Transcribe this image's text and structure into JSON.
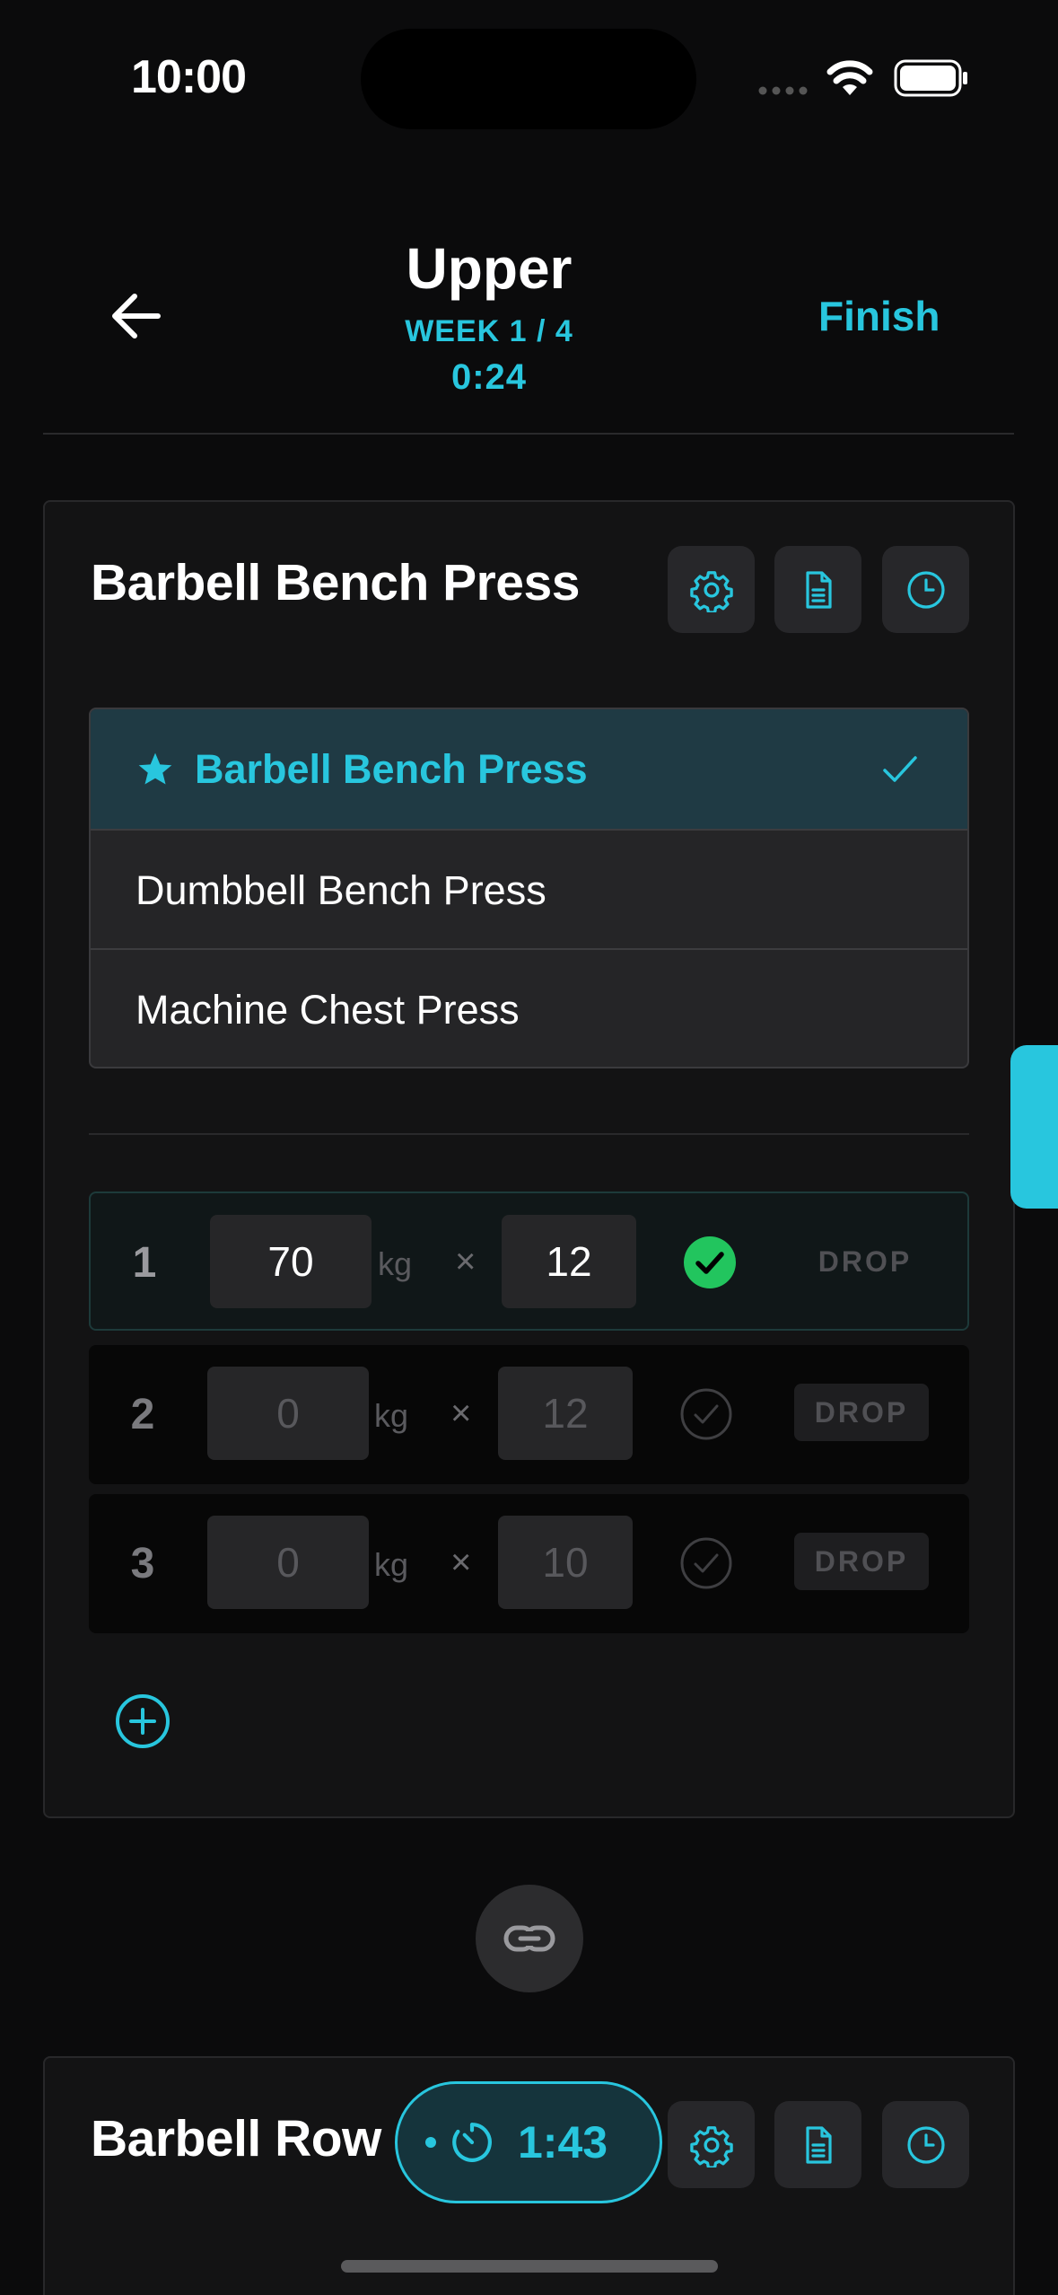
{
  "status_bar": {
    "time": "10:00"
  },
  "header": {
    "title": "Upper",
    "week": "WEEK 1 / 4",
    "elapsed": "0:24",
    "finish_label": "Finish"
  },
  "exercise": {
    "name": "Barbell Bench Press",
    "options": [
      {
        "label": "Barbell Bench Press",
        "selected": true
      },
      {
        "label": "Dumbbell Bench Press",
        "selected": false
      },
      {
        "label": "Machine Chest Press",
        "selected": false
      }
    ],
    "sets": [
      {
        "number": "1",
        "weight": "70",
        "unit": "kg",
        "times": "×",
        "reps": "12",
        "completed": true,
        "drop_label": "DROP"
      },
      {
        "number": "2",
        "weight": "0",
        "unit": "kg",
        "times": "×",
        "reps": "12",
        "completed": false,
        "drop_label": "DROP"
      },
      {
        "number": "3",
        "weight": "0",
        "unit": "kg",
        "times": "×",
        "reps": "10",
        "completed": false,
        "drop_label": "DROP"
      }
    ]
  },
  "next_exercise": {
    "name": "Barbell Row"
  },
  "rest_timer": {
    "value": "1:43"
  },
  "colors": {
    "accent": "#28c6de",
    "success": "#22c55e",
    "background": "#0b0b0c",
    "card": "#131314"
  },
  "icons": [
    "back-arrow-icon",
    "gear-icon",
    "document-icon",
    "clock-icon",
    "star-icon",
    "check-icon",
    "add-set-icon",
    "link-icon",
    "timer-icon"
  ]
}
